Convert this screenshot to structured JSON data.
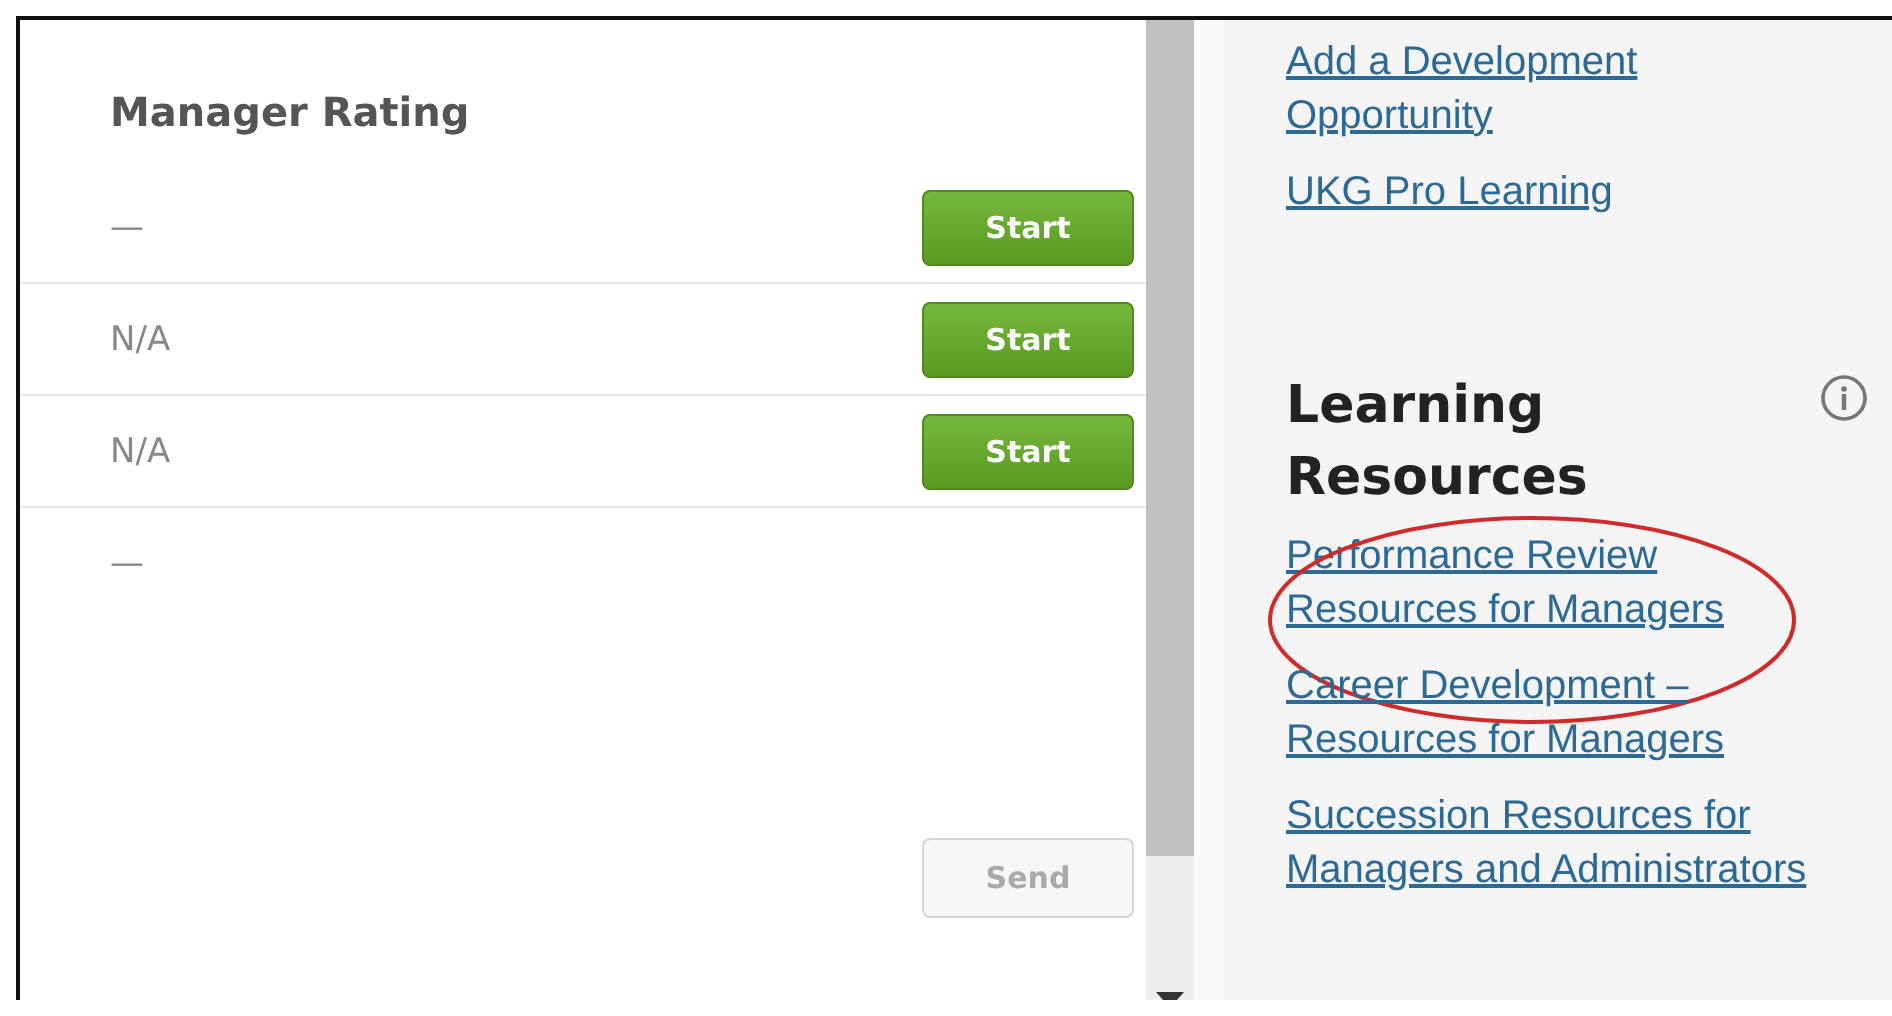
{
  "manager_rating": {
    "title": "Manager Rating",
    "rows": [
      {
        "value": "—",
        "button": "Start"
      },
      {
        "value": "N/A",
        "button": "Start"
      },
      {
        "value": "N/A",
        "button": "Start"
      },
      {
        "value": "—"
      }
    ],
    "send_button": {
      "label": "Send",
      "disabled": true
    }
  },
  "development_links": [
    {
      "label": "Add a Development\nOpportunity"
    },
    {
      "label": "UKG Pro Learning"
    }
  ],
  "learning_resources": {
    "title": "Learning\nResources",
    "links": [
      {
        "label": "Performance Review\nResources for Managers",
        "circled": true
      },
      {
        "label": "Career Development –\nResources for Managers",
        "circled": false
      },
      {
        "label": "Succession Resources for\nManagers and Administrators",
        "circled": false
      }
    ]
  }
}
